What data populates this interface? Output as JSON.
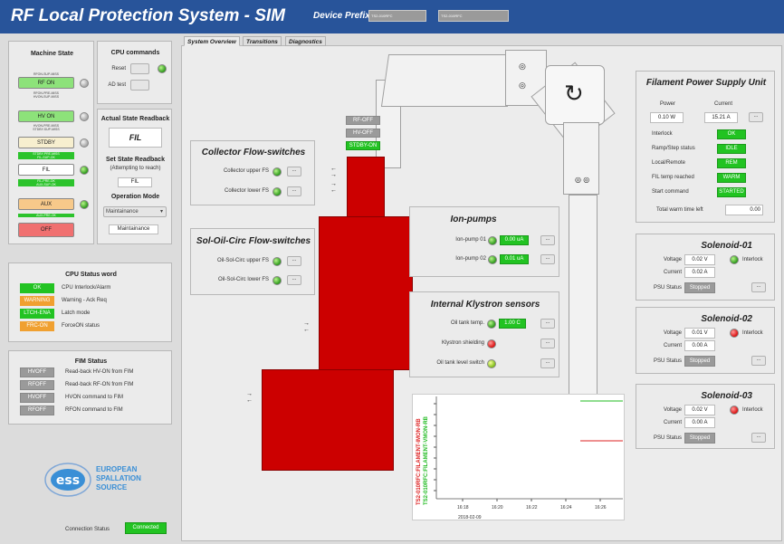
{
  "header": {
    "title": "RF Local Protection System - SIM",
    "device_prefix_label": "Device Prefix",
    "prefix1": "TS2-010RFC",
    "prefix2": "TS2-010RFC"
  },
  "tabs": [
    "System Overview",
    "Transitions",
    "Diagnostics"
  ],
  "machine_state": {
    "title": "Machine State",
    "states": [
      {
        "top_label": "RFON-SUP-MISS",
        "label": "RF ON",
        "color": "green",
        "mid_label": "RFON-PRE-MISS\nHVON-SUP-MISS"
      },
      {
        "label": "HV ON",
        "color": "green",
        "mid_label": "HVON-PRE-MISS\nSTDBY-SUP-MISS"
      },
      {
        "label": "STDBY",
        "color": "cream",
        "mid_label": "STDBY-PRE-MISS\nFIL-SUP-OK"
      },
      {
        "label": "FIL",
        "color": "white",
        "mid_label": "FIL-PRE-OK\nAUX-SUP-OK"
      },
      {
        "label": "AUX",
        "color": "orange",
        "mid_label": "AUX-PRE-OK"
      },
      {
        "label": "OFF",
        "color": "red"
      }
    ]
  },
  "cpu_commands": {
    "title": "CPU commands",
    "reset": "Reset",
    "ad_test": "AD test"
  },
  "actual_state": {
    "title": "Actual State Readback",
    "value": "FIL",
    "set_title": "Set State Readback",
    "set_sub": "(Attempting to reach)",
    "set_value": "FIL",
    "mode_title": "Operation Mode",
    "mode_select": "Maintainance",
    "mode_value": "Maintainance"
  },
  "cpu_status": {
    "title": "CPU Status word",
    "rows": [
      {
        "badge": "OK",
        "text": "CPU Interlock/Alarm",
        "color": "#22c322"
      },
      {
        "badge": "WARNING",
        "text": "Warning - Ack Req",
        "color": "#f0a030"
      },
      {
        "badge": "LTCH-ENA",
        "text": "Latch mode",
        "color": "#22c322"
      },
      {
        "badge": "FRC-ON",
        "text": "ForceON status",
        "color": "#f0a030"
      }
    ]
  },
  "fim_status": {
    "title": "FIM Status",
    "rows": [
      {
        "badge": "HVOFF",
        "text": "Read-back HV-ON from FIM"
      },
      {
        "badge": "RFOFF",
        "text": "Read-back RF-ON from FIM"
      },
      {
        "badge": "HVOFF",
        "text": "HVON command to FIM"
      },
      {
        "badge": "RFOFF",
        "text": "RFON command to FIM"
      }
    ]
  },
  "logo": {
    "line1": "EUROPEAN",
    "line2": "SPALLATION",
    "line3": "SOURCE"
  },
  "connection": {
    "label": "Connection Status",
    "value": "Connected"
  },
  "klystron_state": {
    "rf": "RF-OFF",
    "hv": "HV-OFF",
    "stdby": "STDBY-ON"
  },
  "collector_fs": {
    "title": "Collector Flow-switches",
    "upper": "Collector upper FS",
    "lower": "Collector lower FS"
  },
  "sol_oil_fs": {
    "title": "Sol-Oil-Circ Flow-switches",
    "upper": "Oil-Sol-Circ upper FS",
    "lower": "Oil-Sol-Circ lower FS"
  },
  "ion_pumps": {
    "title": "Ion-pumps",
    "rows": [
      {
        "label": "Ion-pump 01",
        "value": "0.00 uA"
      },
      {
        "label": "Ion-pump 02",
        "value": "0.01 uA"
      }
    ]
  },
  "klystron_sensors": {
    "title": "Internal Klystron sensors",
    "oil_temp": "Oil tank temp.",
    "oil_temp_value": "1.00 C",
    "shielding": "Klystron shielding",
    "oil_level": "Oil tank level switch"
  },
  "filament": {
    "title": "Filament Power Supply Unit",
    "power_label": "Power",
    "current_label": "Current",
    "power": "0.10 W",
    "current": "15.21 A",
    "rows": [
      {
        "label": "Interlock",
        "value": "OK"
      },
      {
        "label": "Ramp/Step status",
        "value": "IDLE"
      },
      {
        "label": "Local/Remote",
        "value": "REM"
      },
      {
        "label": "FIL temp reached",
        "value": "WARM"
      },
      {
        "label": "Start command",
        "value": "STARTED"
      }
    ],
    "warm_label": "Total warm time left",
    "warm_value": "0.00"
  },
  "solenoids": [
    {
      "title": "Solenoid-01",
      "voltage": "0.02 V",
      "current": "0.02 A",
      "interlock": "Interlock",
      "psu": "Stopped",
      "led": "on"
    },
    {
      "title": "Solenoid-02",
      "voltage": "0.01 V",
      "current": "0.00 A",
      "interlock": "Interlock",
      "psu": "Stopped",
      "led": "red"
    },
    {
      "title": "Solenoid-03",
      "voltage": "0.02 V",
      "current": "0.00 A",
      "interlock": "Interlock",
      "psu": "Stopped",
      "led": "red"
    }
  ],
  "labels": {
    "voltage": "Voltage",
    "current": "Current",
    "psu": "PSU Status",
    "ellipsis": "..."
  },
  "trend": {
    "y_label_red": "TS2-010RFC:FILAMENT-IMON-RB",
    "y_label_green": "TS2-010RFC:FILAMENT-VMON-RB",
    "x_ticks": [
      "16:18",
      "16:20",
      "16:22",
      "16:24",
      "16:26"
    ],
    "date": "2018-02-09",
    "colors": {
      "red": "#dd2222",
      "green": "#22bb22"
    }
  }
}
